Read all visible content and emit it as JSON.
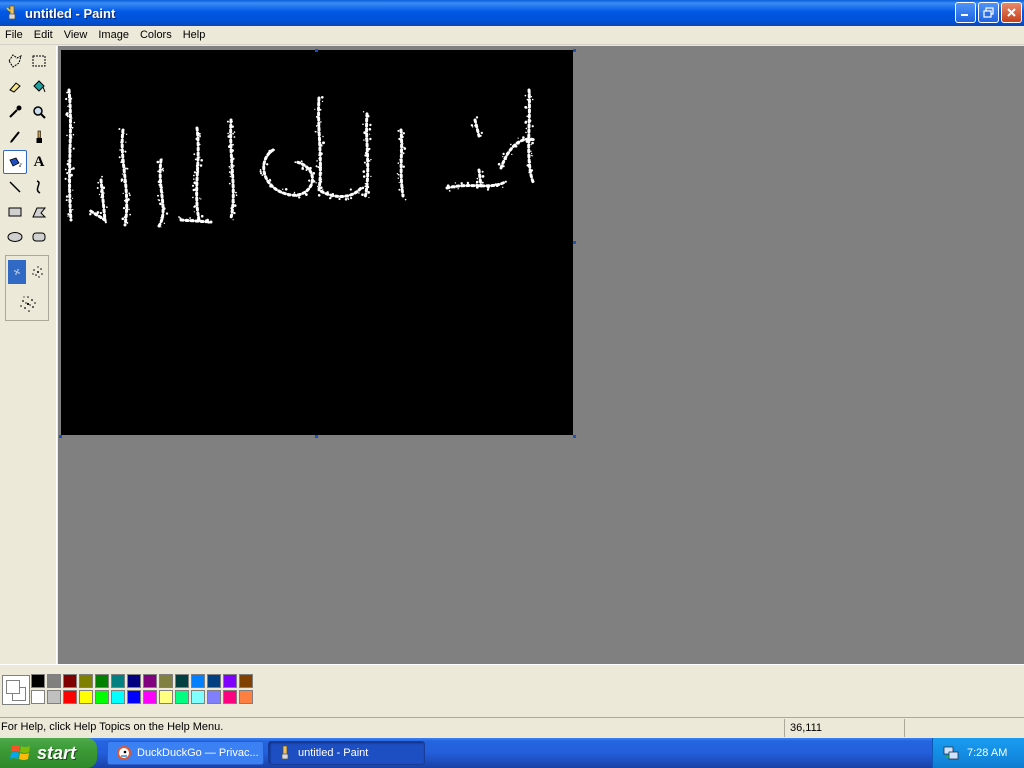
{
  "window": {
    "title": "untitled - Paint",
    "buttons": {
      "minimize": "minimize-icon",
      "restore": "restore-icon",
      "close": "close-icon"
    }
  },
  "menu": [
    "File",
    "Edit",
    "View",
    "Image",
    "Colors",
    "Help"
  ],
  "tools": [
    {
      "name": "free-form-select-icon"
    },
    {
      "name": "rectangle-select-icon"
    },
    {
      "name": "eraser-icon"
    },
    {
      "name": "fill-bucket-icon"
    },
    {
      "name": "pick-color-icon"
    },
    {
      "name": "magnifier-icon"
    },
    {
      "name": "pencil-icon"
    },
    {
      "name": "brush-icon"
    },
    {
      "name": "airbrush-icon",
      "selected": true
    },
    {
      "name": "text-icon",
      "glyph": "A"
    },
    {
      "name": "line-icon"
    },
    {
      "name": "curve-icon"
    },
    {
      "name": "rectangle-icon"
    },
    {
      "name": "polygon-icon"
    },
    {
      "name": "ellipse-icon"
    },
    {
      "name": "rounded-rectangle-icon"
    }
  ],
  "canvas": {
    "background": "#000000",
    "drawing_color": "#ffffff",
    "drawing": "white airbrushed handwriting"
  },
  "palette": {
    "foreground": "#ffffff",
    "background": "#ffffff",
    "row1": [
      "#000000",
      "#808080",
      "#800000",
      "#808000",
      "#008000",
      "#008080",
      "#000080",
      "#800080",
      "#808040",
      "#004040",
      "#0080ff",
      "#004080",
      "#8000ff",
      "#804000"
    ],
    "row2": [
      "#ffffff",
      "#c0c0c0",
      "#ff0000",
      "#ffff00",
      "#00ff00",
      "#00ffff",
      "#0000ff",
      "#ff00ff",
      "#ffff80",
      "#00ff80",
      "#80ffff",
      "#8080ff",
      "#ff0080",
      "#ff8040"
    ]
  },
  "status": {
    "help": "For Help, click Help Topics on the Help Menu.",
    "coords": "36,111"
  },
  "taskbar": {
    "start": "start",
    "tasks": [
      {
        "label": "DuckDuckGo — Privac...",
        "icon": "duckduckgo-icon",
        "active": false
      },
      {
        "label": "untitled - Paint",
        "icon": "paint-icon",
        "active": true
      }
    ],
    "clock": "7:28 AM"
  }
}
